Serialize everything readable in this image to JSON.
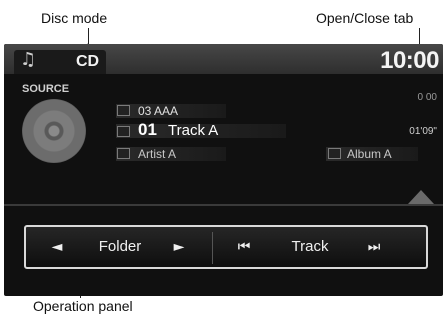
{
  "callouts": {
    "disc_mode": "Disc mode",
    "open_close_tab": "Open/Close tab",
    "operation_panel": "Operation panel"
  },
  "header": {
    "music_icon": "music-note-icon",
    "mode": "CD",
    "clock": "10:00"
  },
  "now_playing": {
    "source_label": "SOURCE",
    "folder": "03  AAA",
    "track_number": "01",
    "track_name": "Track A",
    "artist": "Artist A",
    "album": "Album A",
    "elapsed_time": "0 00",
    "track_time": "01'09\""
  },
  "panel": {
    "folder_prev_icon": "triangle-left-icon",
    "folder_label": "Folder",
    "folder_next_icon": "triangle-right-icon",
    "track_prev_icon": "skip-back-icon",
    "track_label": "Track",
    "track_next_icon": "skip-forward-icon"
  },
  "colors": {
    "screen_bg": "#101010",
    "panel_border": "#d9d9d9",
    "text": "#f0f0f0"
  }
}
